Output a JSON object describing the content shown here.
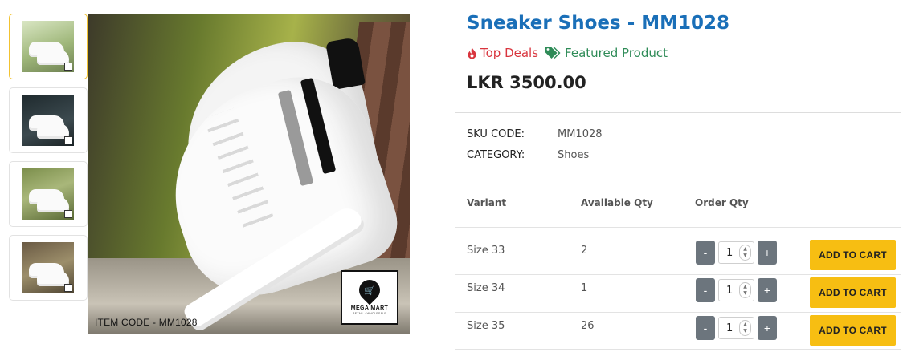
{
  "gallery": {
    "thumbnails": [
      {
        "name": "thumb-1",
        "active": true
      },
      {
        "name": "thumb-2",
        "active": false
      },
      {
        "name": "thumb-3",
        "active": false
      },
      {
        "name": "thumb-4",
        "active": false
      }
    ],
    "main_image": {
      "item_code_text": "ITEM CODE - MM1028",
      "brand_name": "MEGA MART",
      "brand_tagline": "RETAIL · WHOLESALE",
      "brand_icon": "shopping-cart-icon"
    }
  },
  "product": {
    "title": "Sneaker Shoes - MM1028",
    "badges": {
      "top_deals": "Top Deals",
      "featured": "Featured Product"
    },
    "price": "LKR 3500.00",
    "meta": {
      "sku_label": "SKU CODE:",
      "sku_value": "MM1028",
      "category_label": "CATEGORY:",
      "category_value": "Shoes"
    }
  },
  "variants_table": {
    "headers": {
      "variant": "Variant",
      "available_qty": "Available Qty",
      "order_qty": "Order Qty"
    },
    "rows": [
      {
        "variant": "Size 33",
        "available": "2",
        "order_qty": "1",
        "button_label": "ADD TO CART"
      },
      {
        "variant": "Size 34",
        "available": "1",
        "order_qty": "1",
        "button_label": "ADD TO CART"
      },
      {
        "variant": "Size 35",
        "available": "26",
        "order_qty": "1",
        "button_label": "ADD TO CART"
      }
    ],
    "decrement_label": "-",
    "increment_label": "+"
  },
  "colors": {
    "title_blue": "#1a6fb8",
    "deal_red": "#d9353e",
    "featured_green": "#2e8b57",
    "cart_yellow": "#f7be12",
    "qty_button_grey": "#6c757d",
    "thumb_active_border": "#f2c230"
  },
  "icons": {
    "top_deals": "flame-icon",
    "featured": "tags-icon",
    "spinner": "up-down-spinner-icon"
  }
}
